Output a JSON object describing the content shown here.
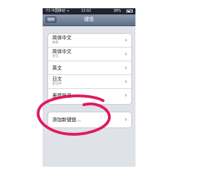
{
  "status_bar": {
    "carrier": "-73 中国移动",
    "wifi": "≈",
    "time": "22:02",
    "battery": "38%"
  },
  "nav": {
    "back_label": "通用",
    "title": "键盘"
  },
  "keyboards": [
    {
      "title": "简体中文",
      "subtitle": "拼音"
    },
    {
      "title": "简体中文",
      "subtitle": "手写"
    },
    {
      "title": "英文",
      "subtitle": ""
    },
    {
      "title": "日文",
      "subtitle": "罗马字"
    },
    {
      "title": "表情符号",
      "subtitle": ""
    }
  ],
  "add_keyboard": {
    "label": "添加新键盘..."
  },
  "chevron": "›",
  "colors": {
    "highlight_circle": "#e11a5b"
  }
}
